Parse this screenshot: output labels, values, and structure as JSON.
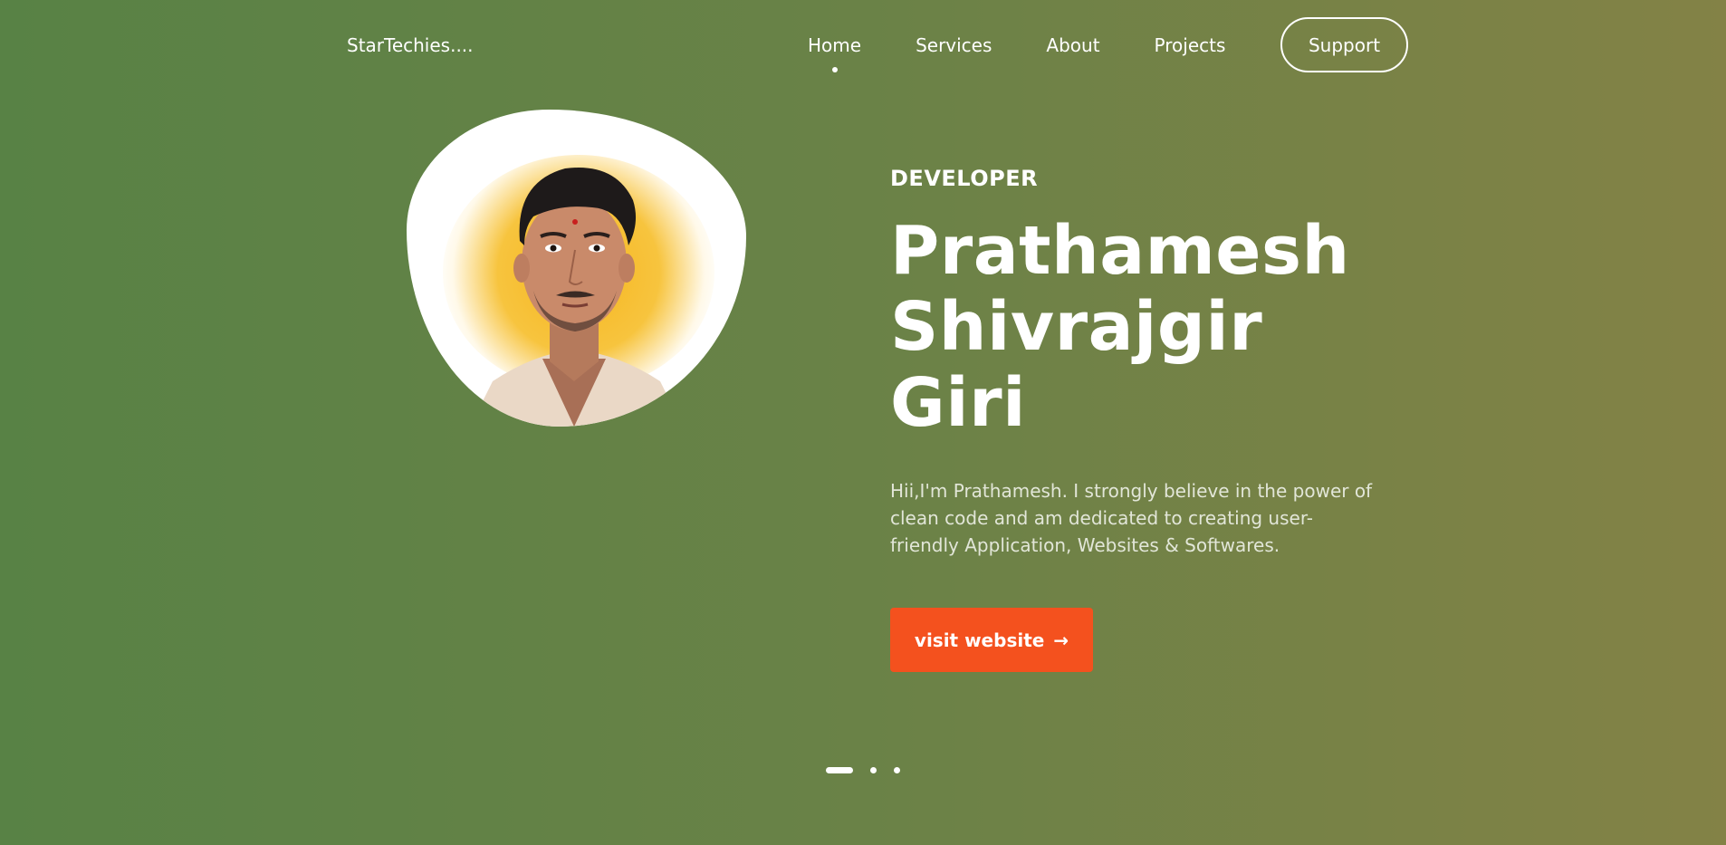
{
  "nav": {
    "logo": "StarTechies....",
    "links": [
      {
        "label": "Home",
        "active": true
      },
      {
        "label": "Services",
        "active": false
      },
      {
        "label": "About",
        "active": false
      },
      {
        "label": "Projects",
        "active": false
      }
    ],
    "support_label": "Support"
  },
  "hero": {
    "role": "DEVELOPER",
    "name_line1": "Prathamesh",
    "name_line2": "Shivrajgir",
    "name_line3": "Giri",
    "bio": "Hii,I'm Prathamesh. I strongly believe in the power of clean code and am dedicated to creating user-friendly Application, Websites & Softwares.",
    "cta_label": "visit website",
    "cta_icon": "arrow-right-icon"
  },
  "slider": {
    "count": 3,
    "active_index": 0
  },
  "colors": {
    "bg_start": "#588245",
    "bg_end": "#838246",
    "accent": "#f4511e",
    "text": "#ffffff"
  }
}
